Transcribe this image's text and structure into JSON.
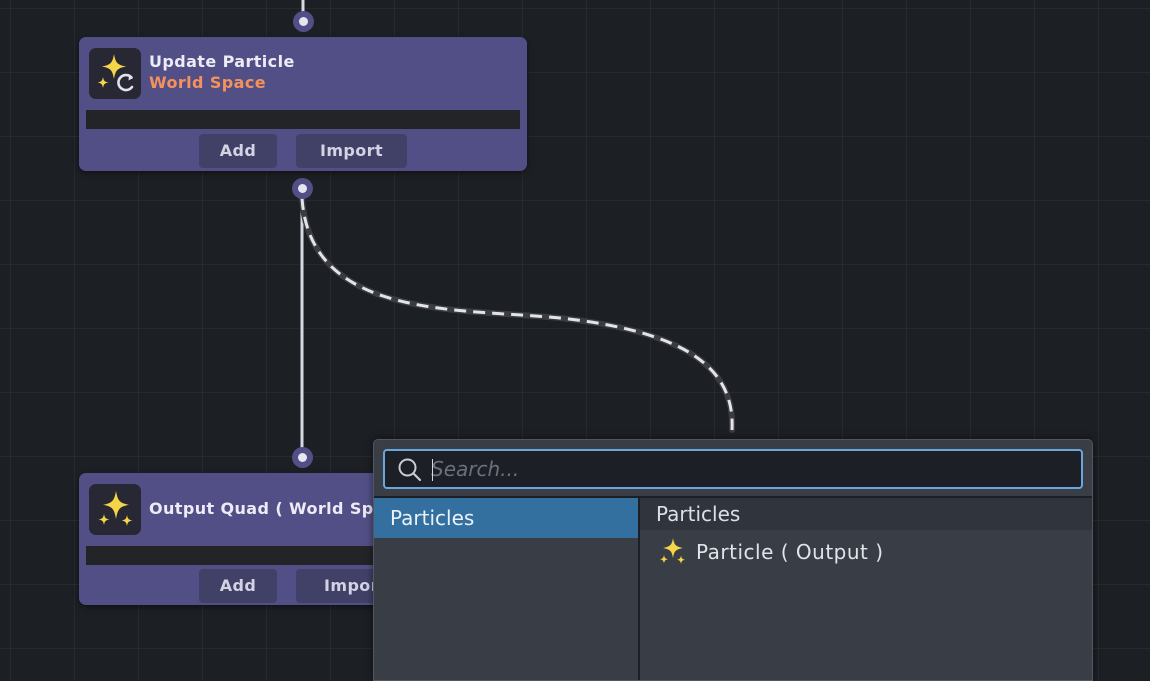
{
  "graph": {
    "nodes": [
      {
        "id": "update",
        "title": "Update Particle",
        "subtitle": "World Space",
        "icon": "sparkle-refresh-icon",
        "buttons": {
          "add": "Add",
          "import": "Import"
        }
      },
      {
        "id": "output",
        "title": "Output Quad ( World Spa",
        "icon": "sparkle-icon",
        "buttons": {
          "add": "Add",
          "import": "Impor"
        }
      }
    ]
  },
  "search": {
    "placeholder": "Search...",
    "value": "",
    "categories": [
      {
        "label": "Particles",
        "selected": true
      }
    ],
    "results": {
      "header": "Particles",
      "items": [
        {
          "label": "Particle ( Output )",
          "icon": "sparkle-icon"
        }
      ]
    }
  },
  "colors": {
    "canvas": "#1c1f24",
    "node": "#514f86",
    "subtitle": "#f6915c",
    "sparkle": "#f5d547",
    "selection": "#336f9f",
    "focus": "#6aa5dc"
  }
}
